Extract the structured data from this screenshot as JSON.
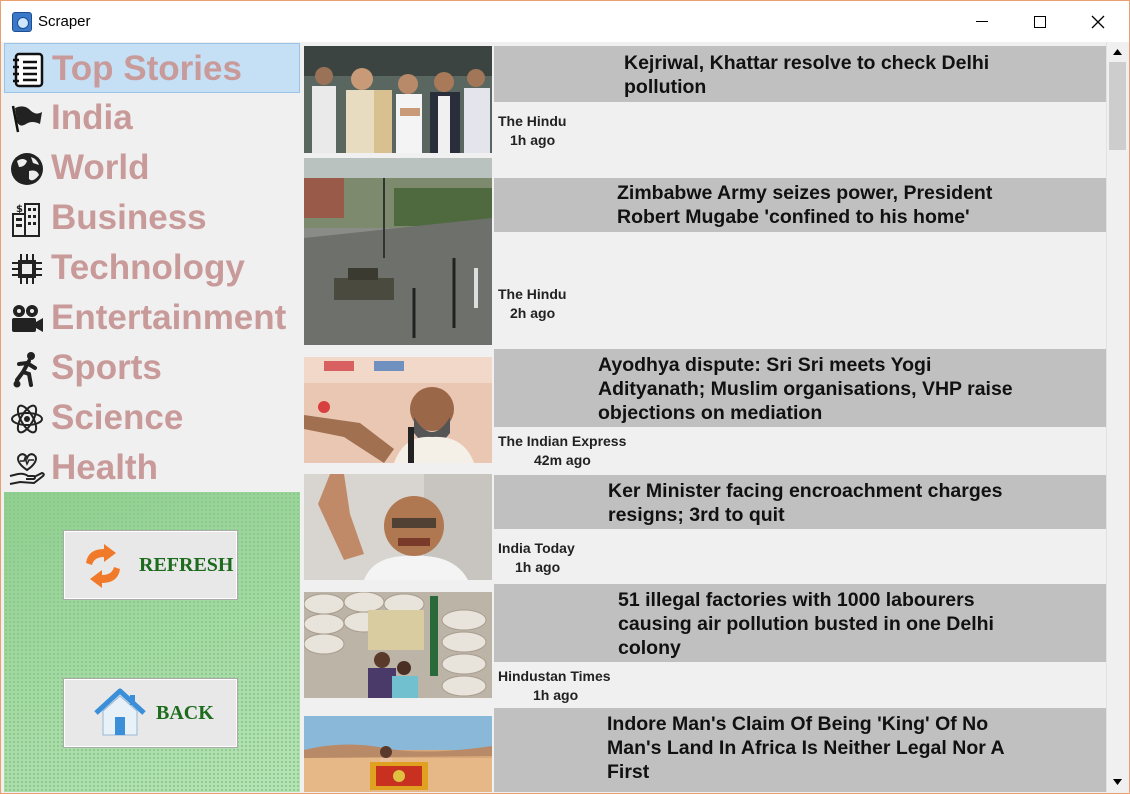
{
  "window": {
    "title": "Scraper"
  },
  "nav": {
    "items": [
      {
        "label": "Top Stories",
        "icon": "notebook-icon",
        "glyph": "📓",
        "active": true
      },
      {
        "label": "India",
        "icon": "flag-icon",
        "glyph": "⚑",
        "active": false
      },
      {
        "label": "World",
        "icon": "globe-icon",
        "glyph": "🌍",
        "active": false
      },
      {
        "label": "Business",
        "icon": "building-icon",
        "glyph": "🏢",
        "active": false
      },
      {
        "label": "Technology",
        "icon": "chip-icon",
        "glyph": "▣",
        "active": false
      },
      {
        "label": "Entertainment",
        "icon": "film-camera-icon",
        "glyph": "🎥",
        "active": false
      },
      {
        "label": "Sports",
        "icon": "soccer-player-icon",
        "glyph": "⚽",
        "active": false
      },
      {
        "label": "Science",
        "icon": "atom-icon",
        "glyph": "⚛",
        "active": false
      },
      {
        "label": "Health",
        "icon": "heart-hand-icon",
        "glyph": "♥",
        "active": false
      }
    ]
  },
  "actions": {
    "refresh_label": "REFRESH",
    "back_label": "BACK"
  },
  "stories": [
    {
      "headline": [
        "Kejriwal, Khattar resolve to check Delhi",
        "pollution"
      ],
      "source": "The Hindu",
      "time": "1h ago",
      "image": "politicians-meeting-photo"
    },
    {
      "headline": [
        "Zimbabwe Army seizes power, President",
        "Robert Mugabe 'confined to his home'"
      ],
      "source": "The Hindu",
      "time": "2h ago",
      "image": "tank-on-street-photo"
    },
    {
      "headline": [
        "Ayodhya dispute: Sri Sri meets Yogi",
        "Adityanath; Muslim organisations, VHP raise",
        "objections on mediation"
      ],
      "source": "The Indian Express",
      "time": "42m ago",
      "image": "speaker-at-podium-photo"
    },
    {
      "headline": [
        "Ker Minister facing encroachment charges",
        "resigns; 3rd to quit"
      ],
      "source": "India Today",
      "time": "1h ago",
      "image": "minister-waving-photo"
    },
    {
      "headline": [
        "51 illegal factories with 1000 labourers",
        "causing air pollution busted in one Delhi",
        "colony"
      ],
      "source": "Hindustan Times",
      "time": "1h ago",
      "image": "factory-sacks-photo"
    },
    {
      "headline": [
        "Indore Man's Claim Of Being 'King' Of No",
        "Man's Land In Africa Is Neither Legal Nor A",
        "First"
      ],
      "source": "",
      "time": "",
      "image": "desert-flag-photo"
    }
  ]
}
